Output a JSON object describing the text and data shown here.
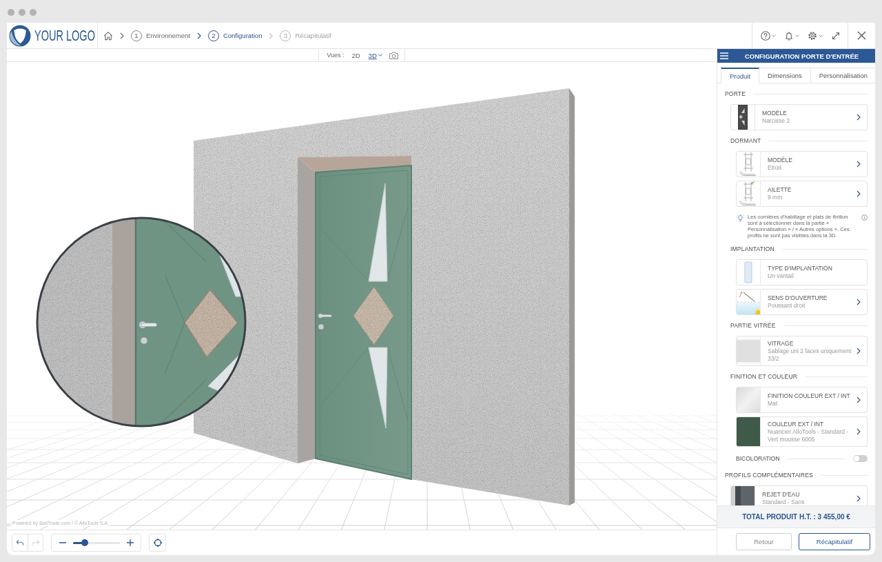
{
  "header": {
    "logo": "YOUR LOGO",
    "steps": [
      {
        "number": "1",
        "label": "Environnement",
        "selected": false,
        "disabled": false
      },
      {
        "number": "2",
        "label": "Configuration",
        "selected": true,
        "disabled": false
      },
      {
        "number": "3",
        "label": "Récapitulatif",
        "selected": false,
        "disabled": true
      }
    ]
  },
  "view_bar": {
    "label": "Vues :",
    "modes": [
      {
        "label": "2D",
        "selected": false
      },
      {
        "label": "3D",
        "selected": true
      }
    ]
  },
  "viewport": {
    "credit": "Powered by BatiTrade.com / © AlloTools S.A."
  },
  "toolbar": {
    "undo": {
      "disabled": false
    },
    "redo": {
      "disabled": true
    },
    "zoom": {
      "level": 0.25
    }
  },
  "panel": {
    "title": "CONFIGURATION PORTE D'ENTRÉE",
    "tabs": [
      {
        "label": "Produit",
        "selected": true
      },
      {
        "label": "Dimensions",
        "selected": false
      },
      {
        "label": "Personnalisation",
        "selected": false
      }
    ],
    "sections": [
      {
        "title": "PORTE",
        "items": [
          {
            "kind": "option",
            "thumbnail": {
              "kind": "door"
            },
            "label": "MODÈLE",
            "value": "Narcisse 2",
            "arrow": true
          }
        ],
        "children": [
          {
            "title": "DORMANT",
            "items": [
              {
                "kind": "option",
                "thumbnail": {
                  "kind": "frame"
                },
                "label": "MODÈLE",
                "value": "Etroit",
                "arrow": true
              },
              {
                "kind": "option",
                "thumbnail": {
                  "kind": "frame-fin"
                },
                "label": "AILETTE",
                "value": "9 mm",
                "arrow": true
              },
              {
                "kind": "note",
                "text": "Les cornières d'habillage et plats de finition sont à sélectionner dans la partie « Personnalisation » / « Autres options ». Ces profils ne sont pas visibles dans la 3D."
              }
            ]
          },
          {
            "title": "IMPLANTATION",
            "items": [
              {
                "kind": "option",
                "thumbnail": {
                  "kind": "leaf"
                },
                "label": "TYPE D'IMPLANTATION",
                "value": "Un vantail",
                "arrow": false
              },
              {
                "kind": "option",
                "thumbnail": {
                  "kind": "swing"
                },
                "label": "SENS D'OUVERTURE",
                "value": "Poussant droit",
                "arrow": true
              }
            ]
          },
          {
            "title": "PARTIE VITRÉE",
            "items": [
              {
                "kind": "option",
                "thumbnail": {
                  "kind": "glass"
                },
                "label": "VITRAGE",
                "value": "Sablage uni 2 faces uniquement 33/2",
                "arrow": true
              }
            ]
          },
          {
            "title": "FINITION ET COULEUR",
            "items": [
              {
                "kind": "option",
                "thumbnail": {
                  "kind": "finish"
                },
                "label": "FINITION COULEUR EXT / INT",
                "value": "Mat",
                "arrow": true
              },
              {
                "kind": "option",
                "thumbnail": {
                  "kind": "color",
                  "color": "#3f5a49"
                },
                "label": "COULEUR EXT / INT",
                "value": "Nuancier AlloTools - Standard - Vert mousse 6005",
                "arrow": true
              },
              {
                "kind": "toggle",
                "label": "BICOLORATION",
                "on": false
              }
            ]
          }
        ]
      },
      {
        "title": "PROFILS COMPLÉMENTAIRES",
        "items": [
          {
            "kind": "option",
            "thumbnail": {
              "kind": "profile"
            },
            "label": "REJET D'EAU",
            "value": "Standard - Sans",
            "arrow": true
          }
        ]
      }
    ],
    "total": "TOTAL PRODUIT H.T. : 3 455,00 €",
    "buttons": [
      {
        "label": "Retour",
        "kind": "back"
      },
      {
        "label": "Récapitulatif",
        "kind": "next"
      }
    ]
  }
}
